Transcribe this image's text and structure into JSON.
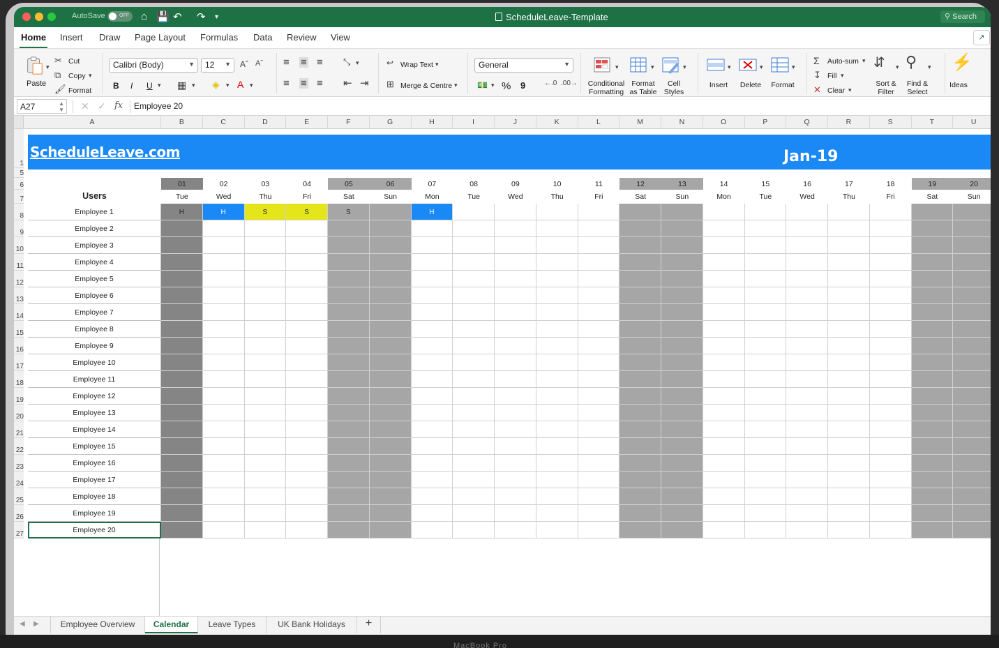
{
  "window": {
    "title": "ScheduleLeave-Template",
    "autosave_label": "AutoSave",
    "autosave_state": "OFF",
    "search_placeholder": "Search"
  },
  "ribbon_tabs": [
    "Home",
    "Insert",
    "Draw",
    "Page Layout",
    "Formulas",
    "Data",
    "Review",
    "View"
  ],
  "ribbon": {
    "paste": "Paste",
    "cut": "Cut",
    "copy": "Copy",
    "format_painter": "Format",
    "font_name": "Calibri (Body)",
    "font_size": "12",
    "bold": "B",
    "italic": "I",
    "underline": "U",
    "wrap_text": "Wrap Text",
    "merge_centre": "Merge & Centre",
    "number_format": "General",
    "percent": "%",
    "comma": "9",
    "conditional_formatting": [
      "Conditional",
      "Formatting"
    ],
    "format_as_table": [
      "Format",
      "as Table"
    ],
    "cell_styles": [
      "Cell",
      "Styles"
    ],
    "insert": "Insert",
    "delete": "Delete",
    "format": "Format",
    "autosum": "Auto-sum",
    "fill": "Fill",
    "clear": "Clear",
    "sort_filter": [
      "Sort &",
      "Filter"
    ],
    "find_select": [
      "Find &",
      "Select"
    ],
    "ideas": "Ideas"
  },
  "formula_bar": {
    "name_box": "A27",
    "fx": "fx",
    "value": "Employee 20"
  },
  "columns": [
    "A",
    "B",
    "C",
    "D",
    "E",
    "F",
    "G",
    "H",
    "I",
    "J",
    "K",
    "L",
    "M",
    "N",
    "O",
    "P",
    "Q",
    "R",
    "S",
    "T",
    "U"
  ],
  "rows": [
    "1",
    "5",
    "6",
    "7",
    "8",
    "9",
    "10",
    "11",
    "12",
    "13",
    "14",
    "15",
    "16",
    "17",
    "18",
    "19",
    "20",
    "21",
    "22",
    "23",
    "24",
    "25",
    "26",
    "27"
  ],
  "sheet": {
    "site": "ScheduleLeave.com",
    "month": "Jan-19",
    "users_header": "Users",
    "days": [
      {
        "num": "01",
        "name": "Tue",
        "shade": "dark"
      },
      {
        "num": "02",
        "name": "Wed",
        "shade": "none"
      },
      {
        "num": "03",
        "name": "Thu",
        "shade": "none"
      },
      {
        "num": "04",
        "name": "Fri",
        "shade": "none"
      },
      {
        "num": "05",
        "name": "Sat",
        "shade": "weekend"
      },
      {
        "num": "06",
        "name": "Sun",
        "shade": "weekend"
      },
      {
        "num": "07",
        "name": "Mon",
        "shade": "none"
      },
      {
        "num": "08",
        "name": "Tue",
        "shade": "none"
      },
      {
        "num": "09",
        "name": "Wed",
        "shade": "none"
      },
      {
        "num": "10",
        "name": "Thu",
        "shade": "none"
      },
      {
        "num": "11",
        "name": "Fri",
        "shade": "none"
      },
      {
        "num": "12",
        "name": "Sat",
        "shade": "weekend"
      },
      {
        "num": "13",
        "name": "Sun",
        "shade": "weekend"
      },
      {
        "num": "14",
        "name": "Mon",
        "shade": "none"
      },
      {
        "num": "15",
        "name": "Tue",
        "shade": "none"
      },
      {
        "num": "16",
        "name": "Wed",
        "shade": "none"
      },
      {
        "num": "17",
        "name": "Thu",
        "shade": "none"
      },
      {
        "num": "18",
        "name": "Fri",
        "shade": "none"
      },
      {
        "num": "19",
        "name": "Sat",
        "shade": "weekend"
      },
      {
        "num": "20",
        "name": "Sun",
        "shade": "weekend"
      }
    ],
    "employees": [
      "Employee 1",
      "Employee 2",
      "Employee 3",
      "Employee 4",
      "Employee 5",
      "Employee 6",
      "Employee 7",
      "Employee 8",
      "Employee 9",
      "Employee 10",
      "Employee 11",
      "Employee 12",
      "Employee 13",
      "Employee 14",
      "Employee 15",
      "Employee 16",
      "Employee 17",
      "Employee 18",
      "Employee 19",
      "Employee 20"
    ],
    "leave_entries": [
      {
        "employee": 0,
        "day": 0,
        "code": "H",
        "color": "dark"
      },
      {
        "employee": 0,
        "day": 1,
        "code": "H",
        "color": "blue"
      },
      {
        "employee": 0,
        "day": 2,
        "code": "S",
        "color": "yellow"
      },
      {
        "employee": 0,
        "day": 3,
        "code": "S",
        "color": "yellow"
      },
      {
        "employee": 0,
        "day": 4,
        "code": "S",
        "color": "weekend"
      },
      {
        "employee": 0,
        "day": 6,
        "code": "H",
        "color": "blue"
      }
    ],
    "colors": {
      "banner": "#1a88f5",
      "weekend": "#a6a6a6",
      "holiday_dark": "#858585",
      "holiday_blue": "#1a88f5",
      "sick_yellow": "#e5e51c"
    }
  },
  "sheet_tabs": [
    {
      "label": "Employee Overview",
      "active": false
    },
    {
      "label": "Calendar",
      "active": true
    },
    {
      "label": "Leave Types",
      "active": false
    },
    {
      "label": "UK Bank Holidays",
      "active": false
    }
  ],
  "add_sheet": "+",
  "device_label": "MacBook Pro"
}
